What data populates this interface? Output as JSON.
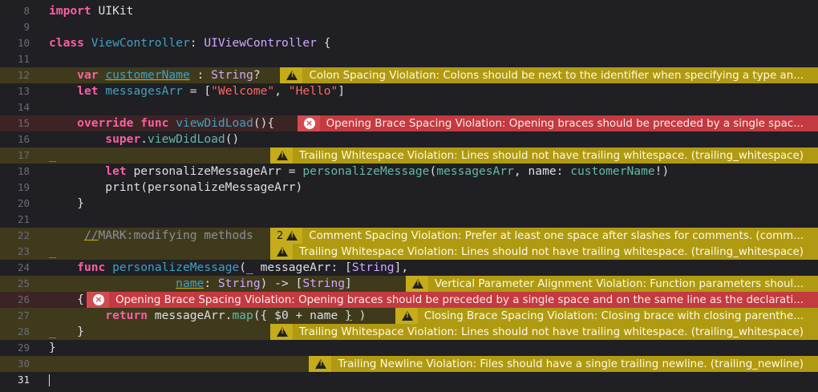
{
  "lines": [
    {
      "n": "8",
      "bg": "",
      "segs": [
        [
          "kw",
          "import"
        ],
        [
          "tok",
          " UIKit"
        ]
      ]
    },
    {
      "n": "9",
      "bg": "",
      "segs": []
    },
    {
      "n": "10",
      "bg": "",
      "segs": [
        [
          "kw",
          "class"
        ],
        [
          "tok",
          " "
        ],
        [
          "id",
          "ViewController"
        ],
        [
          "tok",
          ": "
        ],
        [
          "ty",
          "UIViewController"
        ],
        [
          "tok",
          " {"
        ]
      ]
    },
    {
      "n": "11",
      "bg": "",
      "segs": []
    },
    {
      "n": "12",
      "bg": "warn",
      "segs": [
        [
          "tok",
          "    "
        ],
        [
          "kw",
          "var"
        ],
        [
          "tok",
          " "
        ],
        [
          "id ul",
          "customerName"
        ],
        [
          "tok",
          " : "
        ],
        [
          "ty",
          "String"
        ],
        [
          "tok",
          "?"
        ]
      ],
      "ann": {
        "kind": "warn",
        "count": "",
        "msg": "Colon Spacing Violation: Colons should be next to the identifier when specifying a type an..."
      }
    },
    {
      "n": "13",
      "bg": "",
      "segs": [
        [
          "tok",
          "    "
        ],
        [
          "kw",
          "let"
        ],
        [
          "tok",
          " "
        ],
        [
          "id",
          "messagesArr"
        ],
        [
          "tok",
          " = ["
        ],
        [
          "str",
          "\"Welcome\""
        ],
        [
          "tok",
          ", "
        ],
        [
          "str",
          "\"Hello\""
        ],
        [
          "tok",
          "]"
        ]
      ]
    },
    {
      "n": "14",
      "bg": "",
      "segs": []
    },
    {
      "n": "15",
      "bg": "err",
      "segs": [
        [
          "tok",
          "    "
        ],
        [
          "kw",
          "override"
        ],
        [
          "tok",
          " "
        ],
        [
          "kw",
          "func"
        ],
        [
          "tok",
          " "
        ],
        [
          "id",
          "viewDidLoad"
        ],
        [
          "tok",
          "(){"
        ]
      ],
      "ann": {
        "kind": "err",
        "count": "",
        "msg": "Opening Brace Spacing Violation: Opening braces should be preceded by a single spac..."
      }
    },
    {
      "n": "16",
      "bg": "",
      "segs": [
        [
          "tok",
          "        "
        ],
        [
          "kw",
          "super"
        ],
        [
          "tok",
          "."
        ],
        [
          "fn",
          "viewDidLoad"
        ],
        [
          "tok",
          "()"
        ]
      ]
    },
    {
      "n": "17",
      "bg": "warn",
      "segs": [
        [
          "ws",
          "_"
        ]
      ],
      "ann": {
        "kind": "warn",
        "count": "",
        "msg": "Trailing Whitespace Violation: Lines should not have trailing whitespace. (trailing_whitespace)"
      }
    },
    {
      "n": "18",
      "bg": "",
      "segs": [
        [
          "tok",
          "        "
        ],
        [
          "kw",
          "let"
        ],
        [
          "tok",
          " personalizeMessageArr = "
        ],
        [
          "fn",
          "personalizeMessage"
        ],
        [
          "tok",
          "("
        ],
        [
          "fn",
          "messagesArr"
        ],
        [
          "tok",
          ", name: "
        ],
        [
          "fn",
          "customerName"
        ],
        [
          "tok",
          "!)"
        ]
      ]
    },
    {
      "n": "19",
      "bg": "",
      "segs": [
        [
          "tok",
          "        "
        ],
        [
          "tok",
          "print(personalizeMessageArr)"
        ]
      ]
    },
    {
      "n": "20",
      "bg": "",
      "segs": [
        [
          "tok",
          "    }"
        ]
      ]
    },
    {
      "n": "21",
      "bg": "",
      "segs": []
    },
    {
      "n": "22",
      "bg": "warn",
      "segs": [
        [
          "tok",
          "     "
        ],
        [
          "cm ul",
          "//"
        ],
        [
          "cm",
          "MARK:modifying methods"
        ]
      ],
      "ann": {
        "kind": "warn",
        "count": "2",
        "msg": "Comment Spacing Violation: Prefer at least one space after slashes for comments. (comm..."
      }
    },
    {
      "n": "23",
      "bg": "warn",
      "segs": [
        [
          "ws",
          "_"
        ]
      ],
      "ann": {
        "kind": "warn",
        "count": "",
        "msg": "Trailing Whitespace Violation: Lines should not have trailing whitespace. (trailing_whitespace)"
      }
    },
    {
      "n": "24",
      "bg": "",
      "segs": [
        [
          "tok",
          "    "
        ],
        [
          "kw",
          "func"
        ],
        [
          "tok",
          " "
        ],
        [
          "id",
          "personalizeMessage"
        ],
        [
          "tok",
          "(_ messageArr: ["
        ],
        [
          "ty",
          "String"
        ],
        [
          "tok",
          "],"
        ]
      ]
    },
    {
      "n": "25",
      "bg": "warn",
      "segs": [
        [
          "tok",
          "                  "
        ],
        [
          "id ul",
          "name"
        ],
        [
          "tok",
          ": "
        ],
        [
          "ty",
          "String"
        ],
        [
          "tok",
          ") -> ["
        ],
        [
          "ty",
          "String"
        ],
        [
          "tok",
          "]"
        ]
      ],
      "ann": {
        "kind": "warn",
        "count": "",
        "msg": "Vertical Parameter Alignment Violation: Function parameters shoul..."
      }
    },
    {
      "n": "26",
      "bg": "err",
      "segs": [
        [
          "tok",
          "    {"
        ]
      ],
      "ann": {
        "kind": "err",
        "count": "",
        "msg": "Opening Brace Spacing Violation: Opening braces should be preceded by a single space and on the same line as the declarati..."
      }
    },
    {
      "n": "27",
      "bg": "warn",
      "segs": [
        [
          "tok",
          "        "
        ],
        [
          "kw",
          "return"
        ],
        [
          "tok",
          " messageArr."
        ],
        [
          "fn",
          "map"
        ],
        [
          "tok",
          "({ $0 + name "
        ],
        [
          "tok ul",
          "}"
        ],
        [
          "tok",
          " )"
        ]
      ],
      "ann": {
        "kind": "warn",
        "count": "",
        "msg": "Closing Brace Spacing Violation: Closing brace with closing parenthe..."
      }
    },
    {
      "n": "28",
      "bg": "warn",
      "segs": [
        [
          "ws",
          "_"
        ],
        [
          "tok",
          "   }"
        ]
      ],
      "ann": {
        "kind": "warn",
        "count": "",
        "msg": "Trailing Whitespace Violation: Lines should not have trailing whitespace. (trailing_whitespace)"
      }
    },
    {
      "n": "29",
      "bg": "",
      "segs": [
        [
          "tok",
          "}"
        ]
      ]
    },
    {
      "n": "30",
      "bg": "warn",
      "segs": [],
      "ann": {
        "kind": "warn",
        "count": "",
        "msg": "Trailing Newline Violation: Files should have a single trailing newline. (trailing_newline)"
      }
    },
    {
      "n": "31",
      "bg": "",
      "cur": true,
      "segs": []
    }
  ]
}
